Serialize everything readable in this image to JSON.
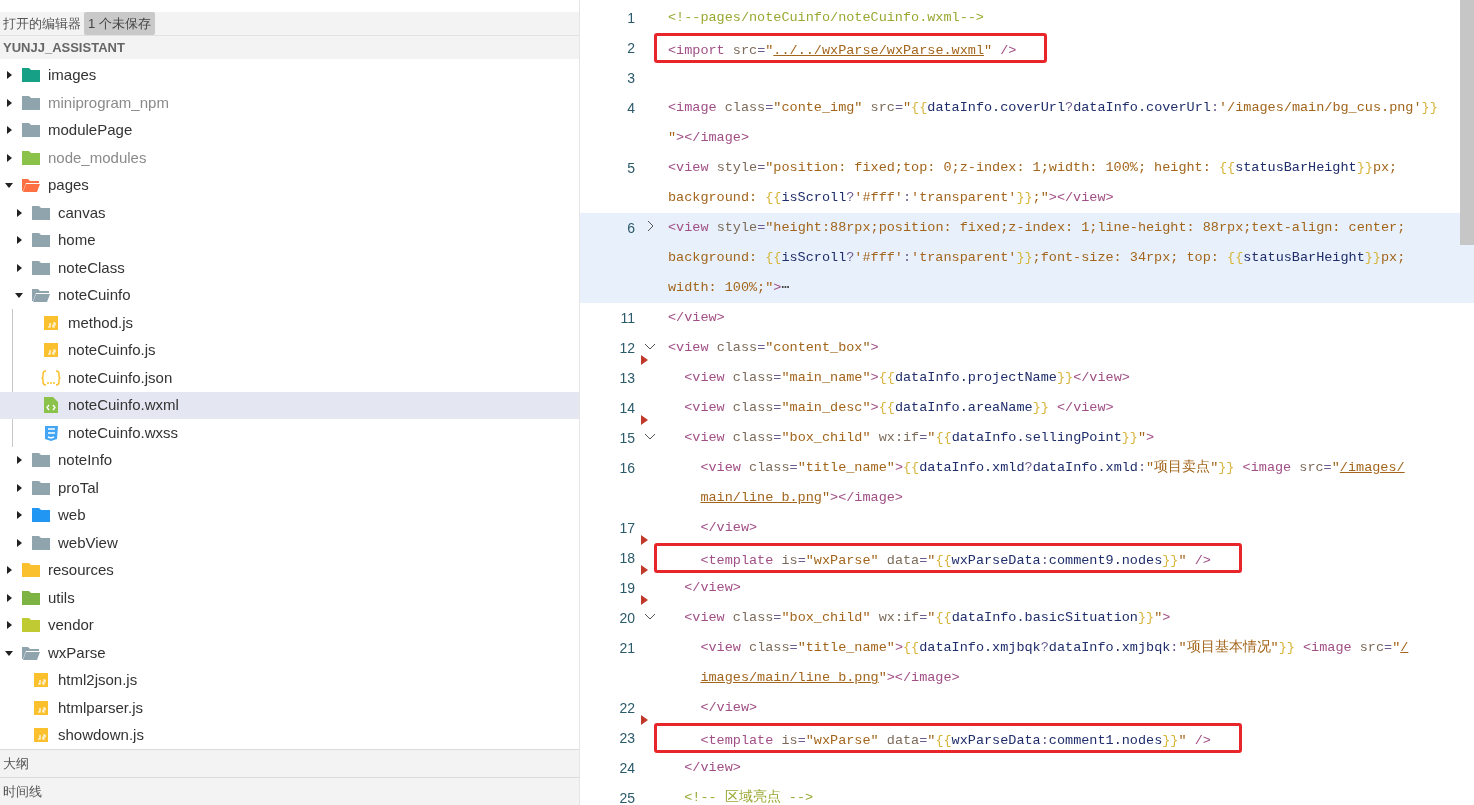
{
  "sidebar": {
    "open_editors": {
      "title": "打开的编辑器",
      "badge": "1 个未保存"
    },
    "project": {
      "title": "YUNJJ_ASSISTANT"
    },
    "tree": [
      {
        "name": "images",
        "kind": "folder",
        "color": "#16a085",
        "expanded": false,
        "selected": false,
        "dimmed": false
      },
      {
        "name": "miniprogram_npm",
        "kind": "folder",
        "color": "#90a4ae",
        "expanded": false,
        "selected": false,
        "dimmed": true
      },
      {
        "name": "modulePage",
        "kind": "folder",
        "color": "#90a4ae",
        "expanded": false,
        "selected": false,
        "dimmed": false
      },
      {
        "name": "node_modules",
        "kind": "folder",
        "color": "#8bc34a",
        "expanded": false,
        "selected": false,
        "dimmed": true
      },
      {
        "name": "pages",
        "kind": "folder",
        "color": "#ff7043",
        "expanded": true,
        "selected": false,
        "dimmed": false,
        "children": [
          {
            "name": "canvas",
            "kind": "folder",
            "color": "#90a4ae",
            "expanded": false,
            "selected": false,
            "dimmed": false
          },
          {
            "name": "home",
            "kind": "folder",
            "color": "#90a4ae",
            "expanded": false,
            "selected": false,
            "dimmed": false
          },
          {
            "name": "noteClass",
            "kind": "folder",
            "color": "#90a4ae",
            "expanded": false,
            "selected": false,
            "dimmed": false
          },
          {
            "name": "noteCuinfo",
            "kind": "folder",
            "color": "#90a4ae",
            "expanded": true,
            "selected": false,
            "dimmed": false,
            "children": [
              {
                "name": "method.js",
                "kind": "js",
                "selected": false,
                "dimmed": false
              },
              {
                "name": "noteCuinfo.js",
                "kind": "js",
                "selected": false,
                "dimmed": false
              },
              {
                "name": "noteCuinfo.json",
                "kind": "json",
                "selected": false,
                "dimmed": false
              },
              {
                "name": "noteCuinfo.wxml",
                "kind": "wxml",
                "selected": true,
                "dimmed": false
              },
              {
                "name": "noteCuinfo.wxss",
                "kind": "wxss",
                "selected": false,
                "dimmed": false
              }
            ]
          },
          {
            "name": "noteInfo",
            "kind": "folder",
            "color": "#90a4ae",
            "expanded": false,
            "selected": false,
            "dimmed": false
          },
          {
            "name": "proTal",
            "kind": "folder",
            "color": "#90a4ae",
            "expanded": false,
            "selected": false,
            "dimmed": false
          },
          {
            "name": "web",
            "kind": "folder",
            "color": "#2196f3",
            "expanded": false,
            "selected": false,
            "dimmed": false
          },
          {
            "name": "webView",
            "kind": "folder",
            "color": "#90a4ae",
            "expanded": false,
            "selected": false,
            "dimmed": false
          }
        ]
      },
      {
        "name": "resources",
        "kind": "folder",
        "color": "#fbc02d",
        "expanded": false,
        "selected": false,
        "dimmed": false
      },
      {
        "name": "utils",
        "kind": "folder",
        "color": "#7cb342",
        "expanded": false,
        "selected": false,
        "dimmed": false
      },
      {
        "name": "vendor",
        "kind": "folder",
        "color": "#c0ca33",
        "expanded": false,
        "selected": false,
        "dimmed": false
      },
      {
        "name": "wxParse",
        "kind": "folder",
        "color": "#90a4ae",
        "expanded": true,
        "selected": false,
        "dimmed": false,
        "children": [
          {
            "name": "html2json.js",
            "kind": "js",
            "selected": false,
            "dimmed": false
          },
          {
            "name": "htmlparser.js",
            "kind": "js",
            "selected": false,
            "dimmed": false
          },
          {
            "name": "showdown.js",
            "kind": "js",
            "selected": false,
            "dimmed": false
          }
        ]
      }
    ],
    "panels": [
      {
        "title": "大纲"
      },
      {
        "title": "时间线"
      }
    ]
  },
  "editor": {
    "lines": [
      {
        "number": "1",
        "rows": [
          {
            "segments": [
              {
                "kind": "comment",
                "text": "<!--pages/noteCuinfo/noteCuinfo.wxml-->"
              }
            ]
          }
        ]
      },
      {
        "number": "2",
        "boxed": true,
        "rows": [
          {
            "segments": [
              {
                "kind": "tag",
                "text": "<import"
              },
              {
                "kind": "attr",
                "text": " src"
              },
              {
                "kind": "punct",
                "text": "="
              },
              {
                "kind": "string",
                "text": "\""
              },
              {
                "kind": "link",
                "text": "../../wxParse/wxParse.wxml"
              },
              {
                "kind": "string",
                "text": "\""
              },
              {
                "kind": "tag",
                "text": " />"
              }
            ]
          }
        ]
      },
      {
        "number": "3",
        "rows": [
          {
            "segments": []
          }
        ]
      },
      {
        "number": "4",
        "rows": [
          {
            "segments": [
              {
                "kind": "tag",
                "text": "<image"
              },
              {
                "kind": "attr",
                "text": " class"
              },
              {
                "kind": "punct",
                "text": "="
              },
              {
                "kind": "string",
                "text": "\"conte_img\""
              },
              {
                "kind": "attr",
                "text": " src"
              },
              {
                "kind": "punct",
                "text": "="
              },
              {
                "kind": "string",
                "text": "\""
              },
              {
                "kind": "brace",
                "text": "{{"
              },
              {
                "kind": "var",
                "text": "dataInfo.coverUrl"
              },
              {
                "kind": "punct",
                "text": "?"
              },
              {
                "kind": "var",
                "text": "dataInfo.coverUrl"
              },
              {
                "kind": "punct",
                "text": ":"
              },
              {
                "kind": "string",
                "text": "'/images/main/bg_cus.png'"
              },
              {
                "kind": "brace",
                "text": "}}"
              }
            ]
          },
          {
            "segments": [
              {
                "kind": "string",
                "text": "\""
              },
              {
                "kind": "tag",
                "text": "></image>"
              }
            ]
          }
        ]
      },
      {
        "number": "5",
        "rows": [
          {
            "segments": [
              {
                "kind": "tag",
                "text": "<view"
              },
              {
                "kind": "attr",
                "text": " style"
              },
              {
                "kind": "punct",
                "text": "="
              },
              {
                "kind": "string",
                "text": "\"position: fixed;top: 0;z-index: 1;width: 100%; height: "
              },
              {
                "kind": "brace",
                "text": "{{"
              },
              {
                "kind": "var",
                "text": "statusBarHeight"
              },
              {
                "kind": "brace",
                "text": "}}"
              },
              {
                "kind": "string",
                "text": "px;"
              }
            ]
          },
          {
            "segments": [
              {
                "kind": "string",
                "text": "background: "
              },
              {
                "kind": "brace",
                "text": "{{"
              },
              {
                "kind": "var",
                "text": "isScroll"
              },
              {
                "kind": "punct",
                "text": "?"
              },
              {
                "kind": "string",
                "text": "'#fff'"
              },
              {
                "kind": "punct",
                "text": ":"
              },
              {
                "kind": "string",
                "text": "'transparent'"
              },
              {
                "kind": "brace",
                "text": "}}"
              },
              {
                "kind": "string",
                "text": ";\""
              },
              {
                "kind": "tag",
                "text": "></view>"
              }
            ]
          }
        ]
      },
      {
        "number": "6",
        "folded": true,
        "current": true,
        "rows": [
          {
            "segments": [
              {
                "kind": "tag",
                "text": "<view"
              },
              {
                "kind": "attr",
                "text": " style"
              },
              {
                "kind": "punct",
                "text": "="
              },
              {
                "kind": "string",
                "text": "\"height:88rpx;position: fixed;z-index: 1;line-height: 88rpx;text-align: center;"
              }
            ]
          },
          {
            "segments": [
              {
                "kind": "string",
                "text": "background: "
              },
              {
                "kind": "brace",
                "text": "{{"
              },
              {
                "kind": "var",
                "text": "isScroll"
              },
              {
                "kind": "punct",
                "text": "?"
              },
              {
                "kind": "string",
                "text": "'#fff'"
              },
              {
                "kind": "punct",
                "text": ":"
              },
              {
                "kind": "string",
                "text": "'transparent'"
              },
              {
                "kind": "brace",
                "text": "}}"
              },
              {
                "kind": "string",
                "text": ";font-size: 34rpx; top: "
              },
              {
                "kind": "brace",
                "text": "{{"
              },
              {
                "kind": "var",
                "text": "statusBarHeight"
              },
              {
                "kind": "brace",
                "text": "}}"
              },
              {
                "kind": "string",
                "text": "px;"
              }
            ]
          },
          {
            "segments": [
              {
                "kind": "string",
                "text": "width: 100%;\""
              },
              {
                "kind": "tag",
                "text": ">"
              },
              {
                "kind": "plain",
                "text": "⋯"
              }
            ]
          }
        ]
      },
      {
        "number": "11",
        "rows": [
          {
            "segments": [
              {
                "kind": "tag",
                "text": "</view>"
              }
            ]
          }
        ]
      },
      {
        "number": "12",
        "folded": false,
        "rows": [
          {
            "segments": [
              {
                "kind": "tag",
                "text": "<view"
              },
              {
                "kind": "attr",
                "text": " class"
              },
              {
                "kind": "punct",
                "text": "="
              },
              {
                "kind": "string",
                "text": "\"content_box\""
              },
              {
                "kind": "tag",
                "text": ">"
              }
            ]
          }
        ]
      },
      {
        "number": "13",
        "change_mark": true,
        "rows": [
          {
            "segments": [
              {
                "kind": "tag",
                "text": "  <view"
              },
              {
                "kind": "attr",
                "text": " class"
              },
              {
                "kind": "punct",
                "text": "="
              },
              {
                "kind": "string",
                "text": "\"main_name\""
              },
              {
                "kind": "tag",
                "text": ">"
              },
              {
                "kind": "brace",
                "text": "{{"
              },
              {
                "kind": "var",
                "text": "dataInfo.projectName"
              },
              {
                "kind": "brace",
                "text": "}}"
              },
              {
                "kind": "tag",
                "text": "</view>"
              }
            ]
          }
        ]
      },
      {
        "number": "14",
        "rows": [
          {
            "segments": [
              {
                "kind": "tag",
                "text": "  <view"
              },
              {
                "kind": "attr",
                "text": " class"
              },
              {
                "kind": "punct",
                "text": "="
              },
              {
                "kind": "string",
                "text": "\"main_desc\""
              },
              {
                "kind": "tag",
                "text": ">"
              },
              {
                "kind": "brace",
                "text": "{{"
              },
              {
                "kind": "var",
                "text": "dataInfo.areaName"
              },
              {
                "kind": "brace",
                "text": "}}"
              },
              {
                "kind": "tag",
                "text": " </view>"
              }
            ]
          }
        ]
      },
      {
        "number": "15",
        "folded": false,
        "change_mark": true,
        "rows": [
          {
            "segments": [
              {
                "kind": "tag",
                "text": "  <view"
              },
              {
                "kind": "attr",
                "text": " class"
              },
              {
                "kind": "punct",
                "text": "="
              },
              {
                "kind": "string",
                "text": "\"box_child\""
              },
              {
                "kind": "attr",
                "text": " wx:if"
              },
              {
                "kind": "punct",
                "text": "="
              },
              {
                "kind": "string",
                "text": "\""
              },
              {
                "kind": "brace",
                "text": "{{"
              },
              {
                "kind": "var",
                "text": "dataInfo.sellingPoint"
              },
              {
                "kind": "brace",
                "text": "}}"
              },
              {
                "kind": "string",
                "text": "\""
              },
              {
                "kind": "tag",
                "text": ">"
              }
            ]
          }
        ]
      },
      {
        "number": "16",
        "rows": [
          {
            "segments": [
              {
                "kind": "tag",
                "text": "    <view"
              },
              {
                "kind": "attr",
                "text": " class"
              },
              {
                "kind": "punct",
                "text": "="
              },
              {
                "kind": "string",
                "text": "\"title_name\""
              },
              {
                "kind": "tag",
                "text": ">"
              },
              {
                "kind": "brace",
                "text": "{{"
              },
              {
                "kind": "var",
                "text": "dataInfo.xmld"
              },
              {
                "kind": "punct",
                "text": "?"
              },
              {
                "kind": "var",
                "text": "dataInfo.xmld"
              },
              {
                "kind": "punct",
                "text": ":"
              },
              {
                "kind": "string",
                "text": "\"项目卖点\""
              },
              {
                "kind": "brace",
                "text": "}}"
              },
              {
                "kind": "tag",
                "text": " <image"
              },
              {
                "kind": "attr",
                "text": " src"
              },
              {
                "kind": "punct",
                "text": "="
              },
              {
                "kind": "string",
                "text": "\""
              },
              {
                "kind": "link",
                "text": "/images/"
              }
            ]
          },
          {
            "segments": [
              {
                "kind": "link",
                "text": "    main/line_b.png"
              },
              {
                "kind": "string",
                "text": "\""
              },
              {
                "kind": "tag",
                "text": "></image>"
              }
            ]
          }
        ]
      },
      {
        "number": "17",
        "rows": [
          {
            "segments": [
              {
                "kind": "tag",
                "text": "    </view>"
              }
            ]
          }
        ]
      },
      {
        "number": "18",
        "boxed": true,
        "change_mark": true,
        "rows": [
          {
            "segments": [
              {
                "kind": "tag",
                "text": "    <template"
              },
              {
                "kind": "attr",
                "text": " is"
              },
              {
                "kind": "punct",
                "text": "="
              },
              {
                "kind": "string",
                "text": "\"wxParse\""
              },
              {
                "kind": "attr",
                "text": " data"
              },
              {
                "kind": "punct",
                "text": "="
              },
              {
                "kind": "string",
                "text": "\""
              },
              {
                "kind": "brace",
                "text": "{{"
              },
              {
                "kind": "var",
                "text": "wxParseData"
              },
              {
                "kind": "punct",
                "text": ":"
              },
              {
                "kind": "var",
                "text": "comment9.nodes"
              },
              {
                "kind": "brace",
                "text": "}}"
              },
              {
                "kind": "string",
                "text": "\""
              },
              {
                "kind": "tag",
                "text": " />"
              }
            ]
          }
        ]
      },
      {
        "number": "19",
        "change_mark": true,
        "rows": [
          {
            "segments": [
              {
                "kind": "tag",
                "text": "  </view>"
              }
            ]
          }
        ]
      },
      {
        "number": "20",
        "folded": false,
        "change_mark": true,
        "rows": [
          {
            "segments": [
              {
                "kind": "tag",
                "text": "  <view"
              },
              {
                "kind": "attr",
                "text": " class"
              },
              {
                "kind": "punct",
                "text": "="
              },
              {
                "kind": "string",
                "text": "\"box_child\""
              },
              {
                "kind": "attr",
                "text": " wx:if"
              },
              {
                "kind": "punct",
                "text": "="
              },
              {
                "kind": "string",
                "text": "\""
              },
              {
                "kind": "brace",
                "text": "{{"
              },
              {
                "kind": "var",
                "text": "dataInfo.basicSituation"
              },
              {
                "kind": "brace",
                "text": "}}"
              },
              {
                "kind": "string",
                "text": "\""
              },
              {
                "kind": "tag",
                "text": ">"
              }
            ]
          }
        ]
      },
      {
        "number": "21",
        "rows": [
          {
            "segments": [
              {
                "kind": "tag",
                "text": "    <view"
              },
              {
                "kind": "attr",
                "text": " class"
              },
              {
                "kind": "punct",
                "text": "="
              },
              {
                "kind": "string",
                "text": "\"title_name\""
              },
              {
                "kind": "tag",
                "text": ">"
              },
              {
                "kind": "brace",
                "text": "{{"
              },
              {
                "kind": "var",
                "text": "dataInfo.xmjbqk"
              },
              {
                "kind": "punct",
                "text": "?"
              },
              {
                "kind": "var",
                "text": "dataInfo.xmjbqk"
              },
              {
                "kind": "punct",
                "text": ":"
              },
              {
                "kind": "string",
                "text": "\"项目基本情况\""
              },
              {
                "kind": "brace",
                "text": "}}"
              },
              {
                "kind": "tag",
                "text": " <image"
              },
              {
                "kind": "attr",
                "text": " src"
              },
              {
                "kind": "punct",
                "text": "="
              },
              {
                "kind": "string",
                "text": "\""
              },
              {
                "kind": "link",
                "text": "/"
              }
            ]
          },
          {
            "segments": [
              {
                "kind": "link",
                "text": "    images/main/line_b.png"
              },
              {
                "kind": "string",
                "text": "\""
              },
              {
                "kind": "tag",
                "text": "></image>"
              }
            ]
          }
        ]
      },
      {
        "number": "22",
        "rows": [
          {
            "segments": [
              {
                "kind": "tag",
                "text": "    </view>"
              }
            ]
          }
        ]
      },
      {
        "number": "23",
        "boxed": true,
        "change_mark": true,
        "rows": [
          {
            "segments": [
              {
                "kind": "tag",
                "text": "    <template"
              },
              {
                "kind": "attr",
                "text": " is"
              },
              {
                "kind": "punct",
                "text": "="
              },
              {
                "kind": "string",
                "text": "\"wxParse\""
              },
              {
                "kind": "attr",
                "text": " data"
              },
              {
                "kind": "punct",
                "text": "="
              },
              {
                "kind": "string",
                "text": "\""
              },
              {
                "kind": "brace",
                "text": "{{"
              },
              {
                "kind": "var",
                "text": "wxParseData"
              },
              {
                "kind": "punct",
                "text": ":"
              },
              {
                "kind": "var",
                "text": "comment1.nodes"
              },
              {
                "kind": "brace",
                "text": "}}"
              },
              {
                "kind": "string",
                "text": "\""
              },
              {
                "kind": "tag",
                "text": " />"
              }
            ]
          }
        ]
      },
      {
        "number": "24",
        "rows": [
          {
            "segments": [
              {
                "kind": "tag",
                "text": "  </view>"
              }
            ]
          }
        ]
      },
      {
        "number": "25",
        "rows": [
          {
            "segments": [
              {
                "kind": "comment",
                "text": "  <!-- 区域亮点 -->"
              }
            ]
          }
        ]
      }
    ]
  }
}
